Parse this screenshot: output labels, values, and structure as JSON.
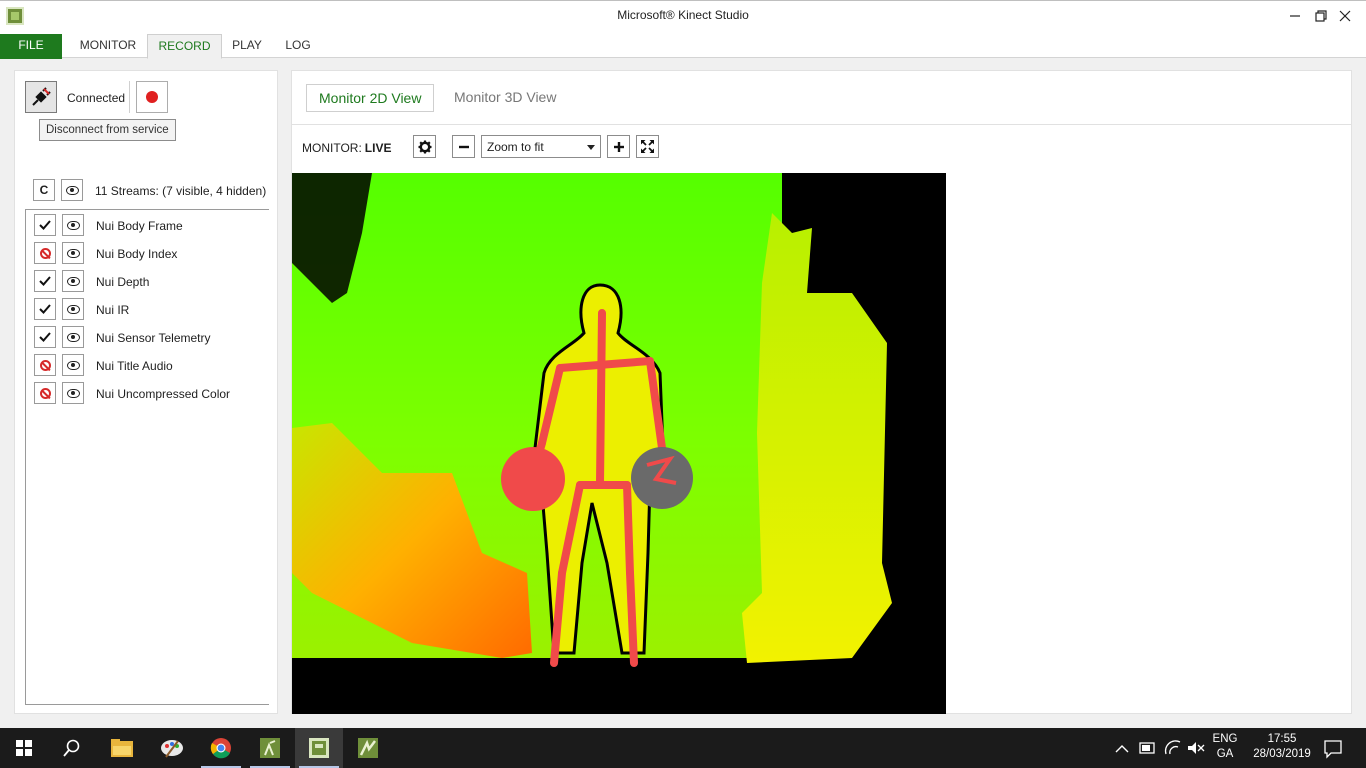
{
  "window": {
    "title": "Microsoft® Kinect Studio",
    "minimize_icon": "minimize-icon",
    "maximize_icon": "restore-icon",
    "close_icon": "close-icon"
  },
  "menu": {
    "file": "FILE",
    "tabs": [
      "MONITOR",
      "RECORD",
      "PLAY",
      "LOG"
    ],
    "active_tab": "RECORD"
  },
  "connection": {
    "status": "Connected",
    "tooltip": "Disconnect from service",
    "plug_icon": "plug-icon",
    "record_icon": "record-icon"
  },
  "streams": {
    "clear_label": "C",
    "summary": "11 Streams: (7 visible, 4 hidden)",
    "items": [
      {
        "label": "Nui Body Frame",
        "state": "enabled"
      },
      {
        "label": "Nui Body Index",
        "state": "disabled"
      },
      {
        "label": "Nui Depth",
        "state": "enabled"
      },
      {
        "label": "Nui IR",
        "state": "enabled"
      },
      {
        "label": "Nui Sensor Telemetry",
        "state": "enabled"
      },
      {
        "label": "Nui Title Audio",
        "state": "disabled"
      },
      {
        "label": "Nui Uncompressed Color",
        "state": "disabled"
      }
    ]
  },
  "views": {
    "tabs": [
      "Monitor 2D View",
      "Monitor 3D View"
    ],
    "active": "Monitor 2D View"
  },
  "monitor": {
    "label": "MONITOR:",
    "status": "LIVE",
    "zoom_value": "Zoom to fit",
    "settings_icon": "gear-icon",
    "zoom_out_icon": "minus-icon",
    "zoom_in_icon": "plus-icon",
    "fullscreen_icon": "expand-icon"
  },
  "taskbar": {
    "apps": [
      "start-icon",
      "search-icon",
      "file-explorer-icon",
      "paint-icon",
      "chrome-icon",
      "kinect-gesture-icon",
      "kinect-studio-icon",
      "kinect-evolution-icon"
    ],
    "lang_top": "ENG",
    "lang_bottom": "GA",
    "time": "17:55",
    "date": "28/03/2019"
  },
  "colors": {
    "accent": "#1e7a1e",
    "record": "#e02020",
    "skeleton": "#f04a4a",
    "depth_near": "#ff7a00",
    "depth_mid": "#f0f000",
    "depth_far": "#50ff00"
  }
}
